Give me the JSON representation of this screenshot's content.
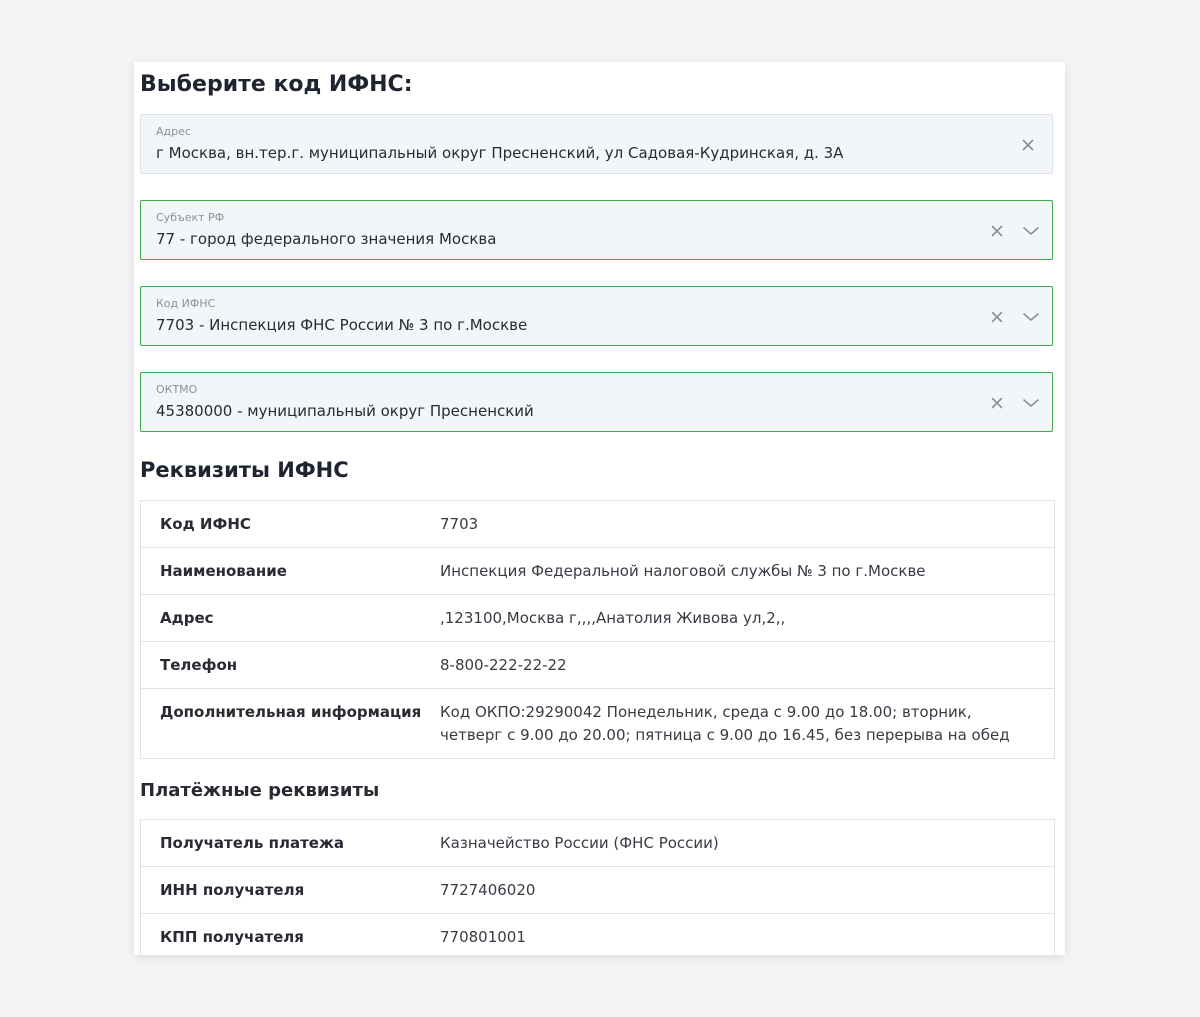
{
  "page_title": "Выберите код ИФНС:",
  "fields": [
    {
      "label": "Адрес",
      "value": "г Москва, вн.тер.г. муниципальный округ Пресненский, ул Садовая-Кудринская, д. 3А"
    },
    {
      "label": "Субъект РФ",
      "value": "77 - город федерального значения Москва"
    },
    {
      "label": "Код ИФНС",
      "value": "7703 - Инспекция ФНС России № 3 по г.Москве"
    },
    {
      "label": "ОКТМО",
      "value": "45380000 - муниципальный округ Пресненский"
    }
  ],
  "icons": {
    "clear": "close-icon",
    "dropdown": "chevron-down-icon"
  },
  "colors": {
    "field_bg": "#f3f6f9",
    "active_border": "#3fa94a",
    "text": "#2a2a33",
    "muted": "#8a8f99"
  },
  "requisites": {
    "title": "Реквизиты ИФНС",
    "rows": [
      {
        "key": "Код ИФНС",
        "value": "7703"
      },
      {
        "key": "Наименование",
        "value": "Инспекция Федеральной налоговой службы № 3 по г.Москве"
      },
      {
        "key": "Адрес",
        "value": ",123100,Москва г,,,,Анатолия Живова ул,2,,"
      },
      {
        "key": "Телефон",
        "value": "8-800-222-22-22"
      },
      {
        "key": "Дополнительная информация",
        "value": "Код ОКПО:29290042 Понедельник, среда с 9.00 до 18.00; вторник, четверг с 9.00 до 20.00; пятница с 9.00 до 16.45, без перерыва на обед"
      }
    ]
  },
  "payment": {
    "title": "Платёжные реквизиты",
    "rows": [
      {
        "key": "Получатель платежа",
        "value": "Казначейство России (ФНС России)"
      },
      {
        "key": "ИНН получателя",
        "value": "7727406020"
      },
      {
        "key": "КПП получателя",
        "value": "770801001"
      }
    ]
  }
}
